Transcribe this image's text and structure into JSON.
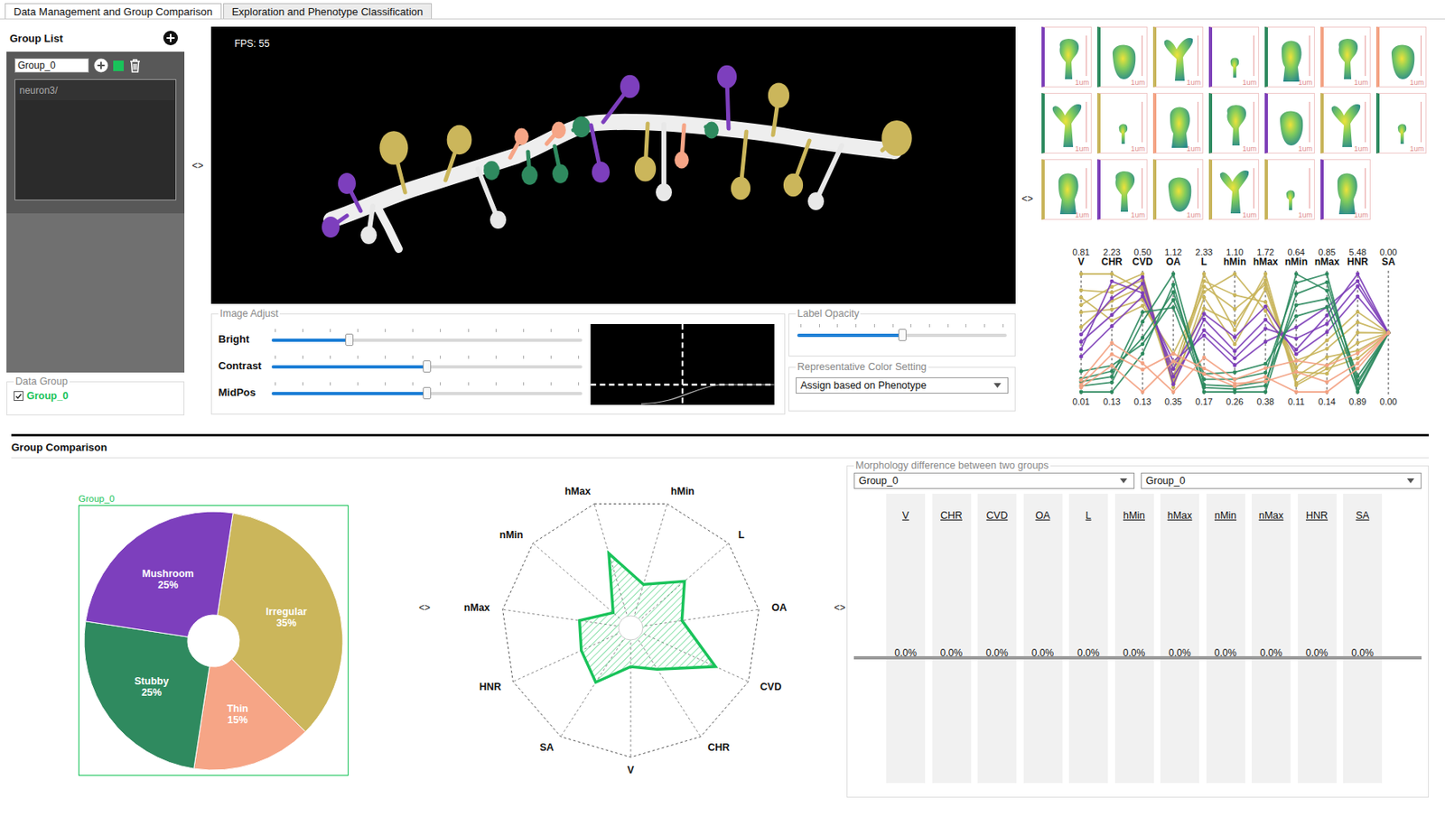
{
  "tabs": [
    {
      "label": "Data Management and Group Comparison",
      "selected": true
    },
    {
      "label": "Exploration and Phenotype Classification",
      "selected": false
    }
  ],
  "group_list": {
    "title": "Group List",
    "groups": [
      {
        "name": "Group_0",
        "color": "#19c35a",
        "items": [
          {
            "label": "neuron3/",
            "selected": true
          }
        ]
      }
    ]
  },
  "data_group": {
    "title": "Data Group",
    "items": [
      {
        "label": "Group_0",
        "checked": true,
        "color": "#19c35a"
      }
    ]
  },
  "viewer": {
    "fps": "FPS: 55"
  },
  "image_adjust": {
    "title": "Image Adjust",
    "sliders": [
      {
        "label": "Bright",
        "level": 0.25
      },
      {
        "label": "Contrast",
        "level": 0.5
      },
      {
        "label": "MidPos",
        "level": 0.5
      }
    ]
  },
  "label_opacity": {
    "title": "Label Opacity",
    "level": 0.5
  },
  "color_setting": {
    "title": "Representative Color Setting",
    "value": "Assign based on Phenotype"
  },
  "thumbnails": [
    {
      "color": "#7d3fb8",
      "scale": "1um"
    },
    {
      "color": "#2e8a5f",
      "scale": "1um"
    },
    {
      "color": "#c8b45a",
      "scale": "1um"
    },
    {
      "color": "#7d3fb8",
      "scale": "1um"
    },
    {
      "color": "#2e8a5f",
      "scale": "1um"
    },
    {
      "color": "#f3a283",
      "scale": "1um"
    },
    {
      "color": "#f3a283",
      "scale": "1um"
    },
    {
      "color": "#2e8a5f",
      "scale": "1um"
    },
    {
      "color": "#c8b45a",
      "scale": "1um"
    },
    {
      "color": "#f3a283",
      "scale": "1um"
    },
    {
      "color": "#2e8a5f",
      "scale": "1um"
    },
    {
      "color": "#7d3fb8",
      "scale": "1um"
    },
    {
      "color": "#c8b45a",
      "scale": "1um"
    },
    {
      "color": "#2e8a5f",
      "scale": "1um"
    },
    {
      "color": "#c8b45a",
      "scale": "1um"
    },
    {
      "color": "#7d3fb8",
      "scale": "1um"
    },
    {
      "color": "#c8b45a",
      "scale": "1um"
    },
    {
      "color": "#c8b45a",
      "scale": "1um"
    },
    {
      "color": "#c8b45a",
      "scale": "1um"
    },
    {
      "color": "#7d3fb8",
      "scale": "1um"
    }
  ],
  "parallel_coordinates": {
    "axes": [
      {
        "label": "V",
        "max": "0.81",
        "min": "0.01"
      },
      {
        "label": "CHR",
        "max": "2.23",
        "min": "0.13"
      },
      {
        "label": "CVD",
        "max": "0.50",
        "min": "0.13"
      },
      {
        "label": "OA",
        "max": "1.12",
        "min": "0.35"
      },
      {
        "label": "L",
        "max": "2.33",
        "min": "0.17"
      },
      {
        "label": "hMin",
        "max": "1.10",
        "min": "0.26"
      },
      {
        "label": "hMax",
        "max": "1.72",
        "min": "0.38"
      },
      {
        "label": "nMin",
        "max": "0.64",
        "min": "0.11"
      },
      {
        "label": "nMax",
        "max": "0.85",
        "min": "0.14"
      },
      {
        "label": "HNR",
        "max": "5.48",
        "min": "0.89"
      },
      {
        "label": "SA",
        "max": "0.00",
        "min": "0.00"
      }
    ],
    "series": [
      {
        "color": "#c8b45a",
        "values": [
          0.81,
          2.23,
          0.45,
          0.4,
          2.33,
          0.7,
          1.72,
          0.15,
          0.3,
          2.8,
          0
        ]
      },
      {
        "color": "#c8b45a",
        "values": [
          0.7,
          1.9,
          0.48,
          0.45,
          2.1,
          0.85,
          1.6,
          0.2,
          0.25,
          3.2,
          0
        ]
      },
      {
        "color": "#c8b45a",
        "values": [
          0.6,
          2.0,
          0.5,
          0.38,
          1.9,
          0.6,
          1.55,
          0.18,
          0.35,
          2.5,
          0
        ]
      },
      {
        "color": "#c8b45a",
        "values": [
          0.55,
          1.6,
          0.42,
          0.5,
          2.2,
          0.95,
          1.4,
          0.25,
          0.4,
          3.6,
          0
        ]
      },
      {
        "color": "#c8b45a",
        "values": [
          0.45,
          1.75,
          0.46,
          0.42,
          1.7,
          0.75,
          1.65,
          0.14,
          0.28,
          2.2,
          0
        ]
      },
      {
        "color": "#c8b45a",
        "values": [
          0.65,
          1.4,
          0.4,
          0.6,
          2.0,
          1.1,
          1.3,
          0.22,
          0.45,
          4.0,
          0
        ]
      },
      {
        "color": "#7d3fb8",
        "values": [
          0.4,
          1.8,
          0.49,
          0.4,
          1.5,
          0.55,
          1.2,
          0.3,
          0.6,
          5.48,
          0
        ]
      },
      {
        "color": "#7d3fb8",
        "values": [
          0.35,
          1.5,
          0.47,
          0.45,
          1.3,
          0.5,
          1.1,
          0.35,
          0.55,
          5.0,
          0
        ]
      },
      {
        "color": "#7d3fb8",
        "values": [
          0.3,
          2.1,
          0.44,
          0.5,
          1.6,
          0.65,
          1.35,
          0.28,
          0.5,
          4.6,
          0
        ]
      },
      {
        "color": "#7d3fb8",
        "values": [
          0.25,
          1.3,
          0.43,
          0.55,
          1.2,
          0.45,
          0.95,
          0.4,
          0.65,
          5.2,
          0
        ]
      },
      {
        "color": "#2e8a5f",
        "values": [
          0.05,
          0.3,
          0.35,
          1.12,
          0.3,
          0.3,
          0.5,
          0.5,
          0.7,
          1.2,
          0
        ]
      },
      {
        "color": "#2e8a5f",
        "values": [
          0.1,
          0.5,
          0.3,
          1.0,
          0.4,
          0.35,
          0.6,
          0.6,
          0.85,
          1.0,
          0
        ]
      },
      {
        "color": "#2e8a5f",
        "values": [
          0.08,
          0.4,
          0.38,
          0.9,
          0.25,
          0.28,
          0.45,
          0.64,
          0.75,
          1.5,
          0
        ]
      },
      {
        "color": "#2e8a5f",
        "values": [
          0.15,
          0.6,
          0.28,
          0.95,
          0.5,
          0.4,
          0.7,
          0.45,
          0.65,
          0.89,
          0
        ]
      },
      {
        "color": "#2e8a5f",
        "values": [
          0.01,
          0.13,
          0.25,
          1.05,
          0.17,
          0.26,
          0.38,
          0.55,
          0.8,
          1.3,
          0
        ]
      },
      {
        "color": "#f3a283",
        "values": [
          0.06,
          0.8,
          0.2,
          0.6,
          0.6,
          0.32,
          0.5,
          0.2,
          0.2,
          2.0,
          0
        ]
      },
      {
        "color": "#f3a283",
        "values": [
          0.04,
          0.6,
          0.13,
          0.55,
          0.5,
          0.3,
          0.55,
          0.11,
          0.14,
          1.8,
          0
        ]
      },
      {
        "color": "#f3a283",
        "values": [
          0.09,
          1.0,
          0.22,
          0.35,
          0.8,
          0.35,
          0.65,
          0.25,
          0.3,
          2.4,
          0
        ]
      }
    ]
  },
  "group_comparison": {
    "title": "Group Comparison"
  },
  "pie": {
    "title": "Group_0",
    "color": "#19c35a",
    "slices": [
      {
        "label": "Irregular",
        "percent": "35%",
        "value": 35,
        "color": "#cbb65b"
      },
      {
        "label": "Thin",
        "percent": "15%",
        "value": 15,
        "color": "#f6a586"
      },
      {
        "label": "Stubby",
        "percent": "25%",
        "value": 25,
        "color": "#2f8a5f"
      },
      {
        "label": "Mushroom",
        "percent": "25%",
        "value": 25,
        "color": "#7d3fbd"
      }
    ]
  },
  "radar": {
    "color": "#19c35a",
    "axes": [
      {
        "label": "hMax",
        "value": 0.6
      },
      {
        "label": "hMin",
        "value": 0.35
      },
      {
        "label": "L",
        "value": 0.55
      },
      {
        "label": "OA",
        "value": 0.4
      },
      {
        "label": "CVD",
        "value": 0.72
      },
      {
        "label": "CHR",
        "value": 0.38
      },
      {
        "label": "V",
        "value": 0.3
      },
      {
        "label": "SA",
        "value": 0.5
      },
      {
        "label": "HNR",
        "value": 0.42
      },
      {
        "label": "nMax",
        "value": 0.4
      },
      {
        "label": "nMin",
        "value": 0.18
      }
    ]
  },
  "diff": {
    "title": "Morphology difference between two groups",
    "group_a": "Group_0",
    "group_b": "Group_0",
    "columns": [
      {
        "label": "V",
        "value": "0.0%",
        "level": 0
      },
      {
        "label": "CHR",
        "value": "0.0%",
        "level": 0
      },
      {
        "label": "CVD",
        "value": "0.0%",
        "level": 0
      },
      {
        "label": "OA",
        "value": "0.0%",
        "level": 0
      },
      {
        "label": "L",
        "value": "0.0%",
        "level": 0
      },
      {
        "label": "hMin",
        "value": "0.0%",
        "level": 0
      },
      {
        "label": "hMax",
        "value": "0.0%",
        "level": 0
      },
      {
        "label": "nMin",
        "value": "0.0%",
        "level": 0
      },
      {
        "label": "nMax",
        "value": "0.0%",
        "level": 0
      },
      {
        "label": "HNR",
        "value": "0.0%",
        "level": 0
      },
      {
        "label": "SA",
        "value": "0.0%",
        "level": 0
      }
    ]
  },
  "toggles": [
    "<>",
    "<>",
    "<>",
    "<>"
  ]
}
